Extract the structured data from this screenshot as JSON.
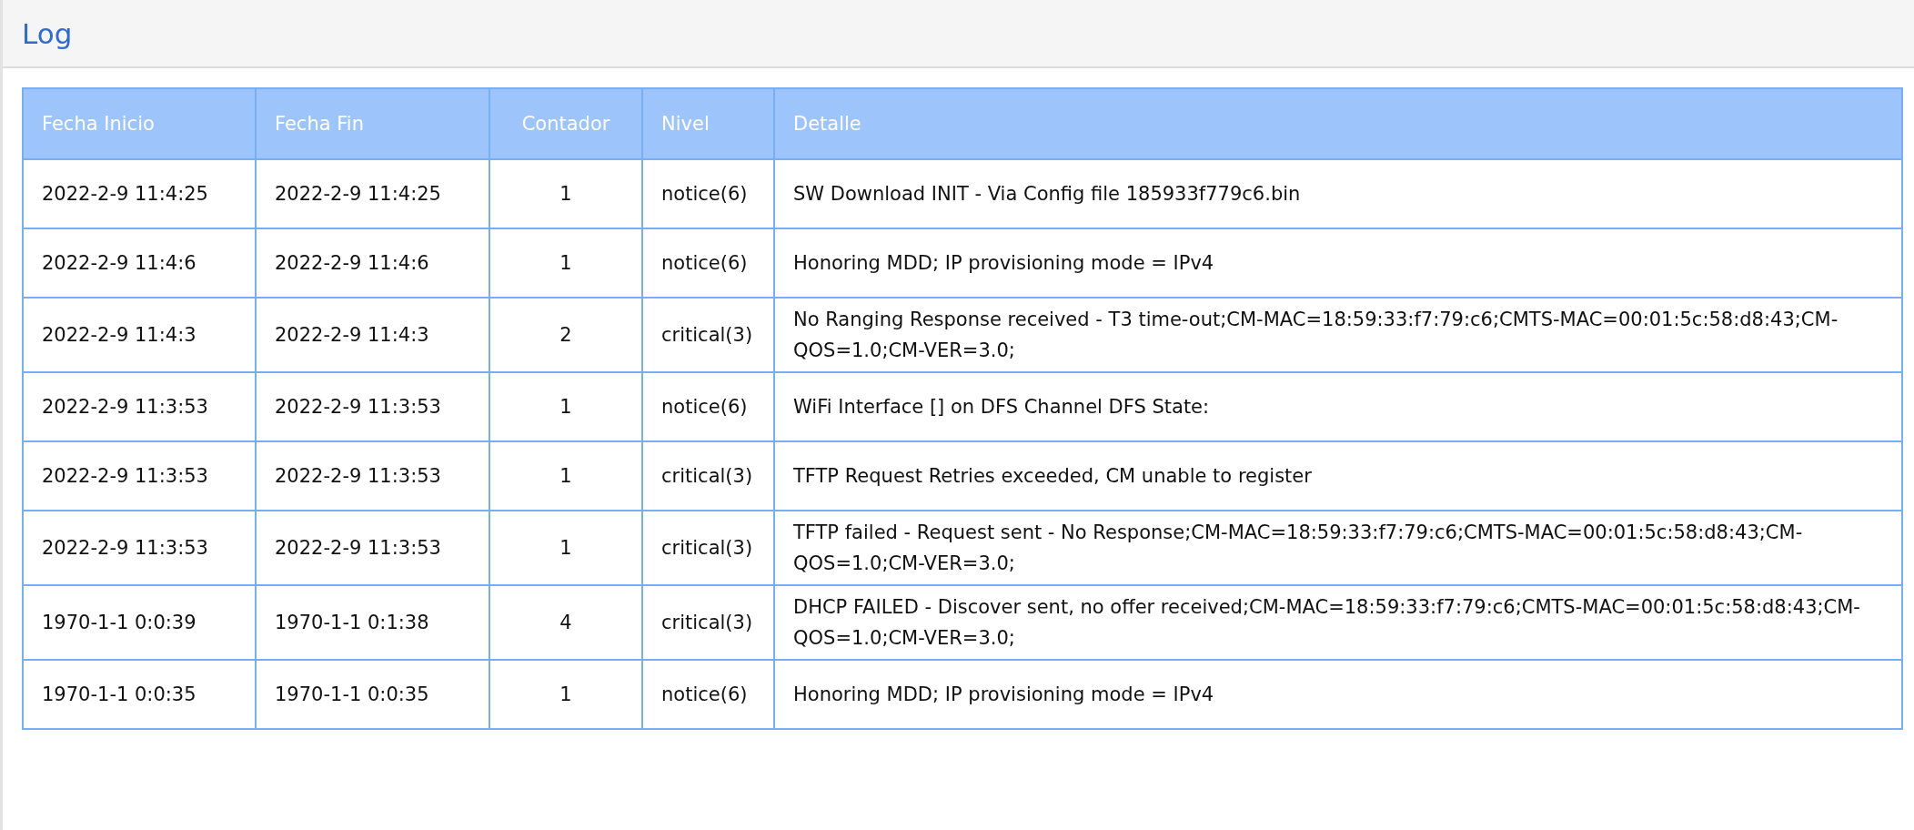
{
  "panel": {
    "title": "Log"
  },
  "table": {
    "columns": [
      "Fecha Inicio",
      "Fecha Fin",
      "Contador",
      "Nivel",
      "Detalle"
    ],
    "rows": [
      [
        "2022-2-9 11:4:25",
        "2022-2-9 11:4:25",
        "1",
        "notice(6)",
        "SW Download INIT - Via Config file 185933f779c6.bin"
      ],
      [
        "2022-2-9 11:4:6",
        "2022-2-9 11:4:6",
        "1",
        "notice(6)",
        "Honoring MDD; IP provisioning mode = IPv4"
      ],
      [
        "2022-2-9 11:4:3",
        "2022-2-9 11:4:3",
        "2",
        "critical(3)",
        "No Ranging Response received - T3 time-out;CM-MAC=18:59:33:f7:79:c6;CMTS-MAC=00:01:5c:58:d8:43;CM-QOS=1.0;CM-VER=3.0;"
      ],
      [
        "2022-2-9 11:3:53",
        "2022-2-9 11:3:53",
        "1",
        "notice(6)",
        "WiFi Interface [] on DFS Channel DFS State:"
      ],
      [
        "2022-2-9 11:3:53",
        "2022-2-9 11:3:53",
        "1",
        "critical(3)",
        "TFTP Request Retries exceeded, CM unable to register"
      ],
      [
        "2022-2-9 11:3:53",
        "2022-2-9 11:3:53",
        "1",
        "critical(3)",
        "TFTP failed - Request sent - No Response;CM-MAC=18:59:33:f7:79:c6;CMTS-MAC=00:01:5c:58:d8:43;CM-QOS=1.0;CM-VER=3.0;"
      ],
      [
        "1970-1-1 0:0:39",
        "1970-1-1 0:1:38",
        "4",
        "critical(3)",
        "DHCP FAILED - Discover sent, no offer received;CM-MAC=18:59:33:f7:79:c6;CMTS-MAC=00:01:5c:58:d8:43;CM-QOS=1.0;CM-VER=3.0;"
      ],
      [
        "1970-1-1 0:0:35",
        "1970-1-1 0:0:35",
        "1",
        "notice(6)",
        "Honoring MDD; IP provisioning mode = IPv4"
      ]
    ]
  }
}
